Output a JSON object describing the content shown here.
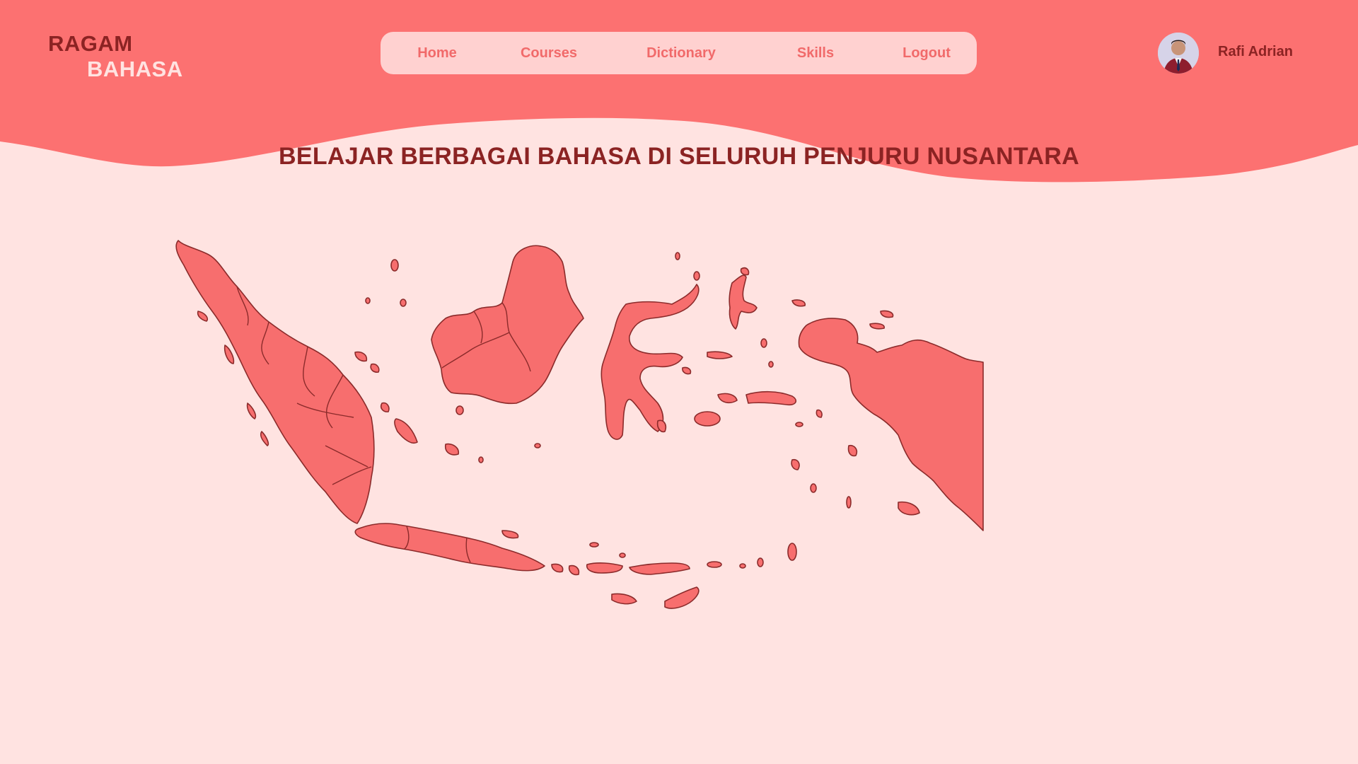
{
  "brand": {
    "line1": "RAGAM",
    "line2": "BAHASA"
  },
  "nav": {
    "items": [
      {
        "label": "Home"
      },
      {
        "label": "Courses"
      },
      {
        "label": "Dictionary"
      },
      {
        "label": "Skills"
      },
      {
        "label": "Logout"
      }
    ]
  },
  "user": {
    "name": "Rafi Adrian",
    "avatar_icon": "user-photo"
  },
  "hero": {
    "title": "BELAJAR BERBAGAI BAHASA DI SELURUH PENJURU NUSANTARA",
    "map_icon": "indonesia-map"
  },
  "colors": {
    "header": "#FC7171",
    "background": "#FFE3E1",
    "accent_dark": "#8B2323",
    "nav_bg": "#FFD1D0",
    "nav_text": "#F16A6A",
    "map_fill": "#F76E6E"
  }
}
